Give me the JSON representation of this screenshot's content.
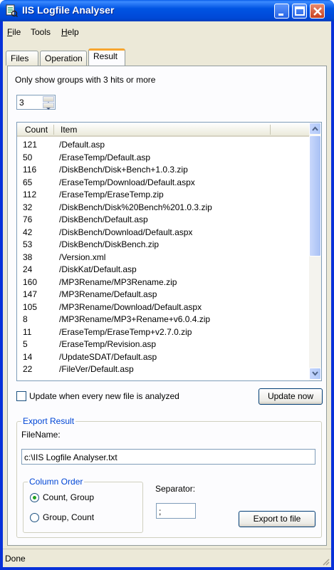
{
  "window": {
    "title": "IIS Logfile Analyser"
  },
  "menu": [
    {
      "label": "File",
      "accel": "F",
      "rest": "ile"
    },
    {
      "label": "Tools",
      "accel": "",
      "rest": "Tools"
    },
    {
      "label": "Help",
      "accel": "H",
      "rest": "elp"
    }
  ],
  "tabs": [
    {
      "label": "Files"
    },
    {
      "label": "Operation"
    },
    {
      "label": "Result"
    }
  ],
  "result": {
    "filter_label": "Only show groups with 3 hits or more",
    "min_hits": "3",
    "columns": [
      "Count",
      "Item"
    ],
    "rows": [
      {
        "count": "121",
        "item": "/Default.asp"
      },
      {
        "count": "50",
        "item": "/EraseTemp/Default.asp"
      },
      {
        "count": "116",
        "item": "/DiskBench/Disk+Bench+1.0.3.zip"
      },
      {
        "count": "65",
        "item": "/EraseTemp/Download/Default.aspx"
      },
      {
        "count": "112",
        "item": "/EraseTemp/EraseTemp.zip"
      },
      {
        "count": "32",
        "item": "/DiskBench/Disk%20Bench%201.0.3.zip"
      },
      {
        "count": "76",
        "item": "/DiskBench/Default.asp"
      },
      {
        "count": "42",
        "item": "/DiskBench/Download/Default.aspx"
      },
      {
        "count": "53",
        "item": "/DiskBench/DiskBench.zip"
      },
      {
        "count": "38",
        "item": "/Version.xml"
      },
      {
        "count": "24",
        "item": "/DiskKat/Default.asp"
      },
      {
        "count": "160",
        "item": "/MP3Rename/MP3Rename.zip"
      },
      {
        "count": "147",
        "item": "/MP3Rename/Default.asp"
      },
      {
        "count": "105",
        "item": "/MP3Rename/Download/Default.aspx"
      },
      {
        "count": "8",
        "item": "/MP3Rename/MP3+Rename+v6.0.4.zip"
      },
      {
        "count": "11",
        "item": "/EraseTemp/EraseTemp+v2.7.0.zip"
      },
      {
        "count": "5",
        "item": "/EraseTemp/Revision.asp"
      },
      {
        "count": "14",
        "item": "/UpdateSDAT/Default.asp"
      },
      {
        "count": "22",
        "item": "/FileVer/Default.asp"
      }
    ],
    "update_checkbox_label": "Update when every new file is analyzed",
    "update_checked": false,
    "update_button": "Update now"
  },
  "export": {
    "group_title": "Export Result",
    "filename_label": "FileName:",
    "filename_value": "c:\\IIS Logfile Analyser.txt",
    "column_order_title": "Column Order",
    "option_count_group": "Count, Group",
    "option_group_count": "Group, Count",
    "selected_order": "Count, Group",
    "separator_label": "Separator:",
    "separator_value": ";",
    "export_button": "Export to file"
  },
  "status": {
    "text": "Done"
  },
  "colors": {
    "titlebar": "#0054e3",
    "accent": "#0046d5",
    "tab_highlight": "#f7a52f",
    "radio_dot": "#21a121"
  }
}
